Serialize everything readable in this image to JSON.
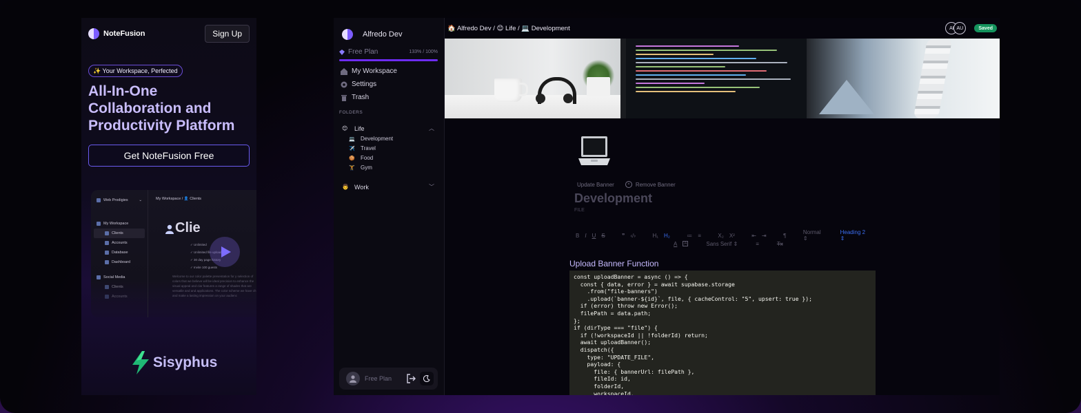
{
  "landing": {
    "brand": "NoteFusion",
    "signup_label": "Sign Up",
    "badge": "✨ Your Workspace, Perfected",
    "hero": "All-In-One Collaboration and Productivity Platform",
    "cta": "Get NoteFusion Free",
    "preview": {
      "workspace": "Web Prodigies",
      "breadcrumb": "My Workspace / 👤 Clients",
      "title": "Clie",
      "side_items": [
        "My Workspace",
        "Clients",
        "Accounts",
        "Database",
        "Dashboard",
        "Social Media",
        "Clients",
        "Accounts"
      ],
      "checks": [
        "Unlimited",
        "Unlimited file uploads",
        "30 day page history",
        "Invite 100 guests"
      ],
      "para": "Welcome to our color palette presentation for y selection of colors that we believe will be ideal precision to enhance the visual appeal and clar features a range of shades that are versatile and and applications. The color scheme we have ch and make a lasting impression on your audienc"
    },
    "sisyphus": "Sisyphus"
  },
  "app": {
    "workspace_name": "Alfredo Dev",
    "plan": {
      "label": "Free Plan",
      "usage": "133% / 100%",
      "fill": 1.0
    },
    "nav": [
      {
        "label": "My Workspace",
        "icon": "home-icon"
      },
      {
        "label": "Settings",
        "icon": "settings-icon"
      },
      {
        "label": "Trash",
        "icon": "trash-icon"
      }
    ],
    "folders_label": "FOLDERS",
    "folders": [
      {
        "emoji": "😊",
        "name": "Life",
        "expanded": true,
        "files": [
          {
            "emoji": "💻",
            "name": "Development"
          },
          {
            "emoji": "✈️",
            "name": "Travel"
          },
          {
            "emoji": "🍪",
            "name": "Food"
          },
          {
            "emoji": "🏋️",
            "name": "Gym"
          }
        ]
      },
      {
        "emoji": "👨",
        "name": "Work",
        "expanded": false,
        "files": []
      }
    ],
    "user_card": {
      "plan": "Free Plan"
    },
    "breadcrumb": "🏠 Alfredo Dev / 😊 Life / 💻 Development",
    "avatars": [
      "AI",
      "AU"
    ],
    "saved": "Saved",
    "doc": {
      "emoji": "💻",
      "update_banner": "Update Banner",
      "remove_banner": "Remove Banner",
      "title": "Development",
      "kind": "FILE"
    },
    "toolbar": {
      "row1": [
        "B",
        "I",
        "U",
        "S",
        "❞",
        "‹/›",
        "H₁",
        "H₂",
        "≔",
        "≡",
        "X₂",
        "X²",
        "⇤",
        "⇥",
        "¶",
        "Normal ⇕"
      ],
      "heading": "Heading 2 ⇕",
      "row2": [
        "A",
        "A",
        "Sans Serif ⇕",
        "≡",
        "Tx"
      ]
    },
    "code_heading": "Upload Banner Function",
    "code_lines": [
      "const uploadBanner = async () => {",
      "  const { data, error } = await supabase.storage",
      "    .from(\"file-banners\")",
      "    .upload(`banner-${id}`, file, { cacheControl: \"5\", upsert: true });",
      "  if (error) throw new Error();",
      "  filePath = data.path;",
      "};",
      "if (dirType === \"file\") {",
      "  if (!workspaceId || !folderId) return;",
      "  await uploadBanner();",
      "  dispatch({",
      "    type: \"UPDATE_FILE\",",
      "    payload: {",
      "      file: { bannerUrl: filePath },",
      "      fileId: id,",
      "      folderId,",
      "      workspaceId,"
    ]
  },
  "colors": {
    "accent": "#6d2cf0",
    "saved_green": "#15935d",
    "hero_text": "#c9bdfc",
    "code_bg": "#23241f"
  }
}
